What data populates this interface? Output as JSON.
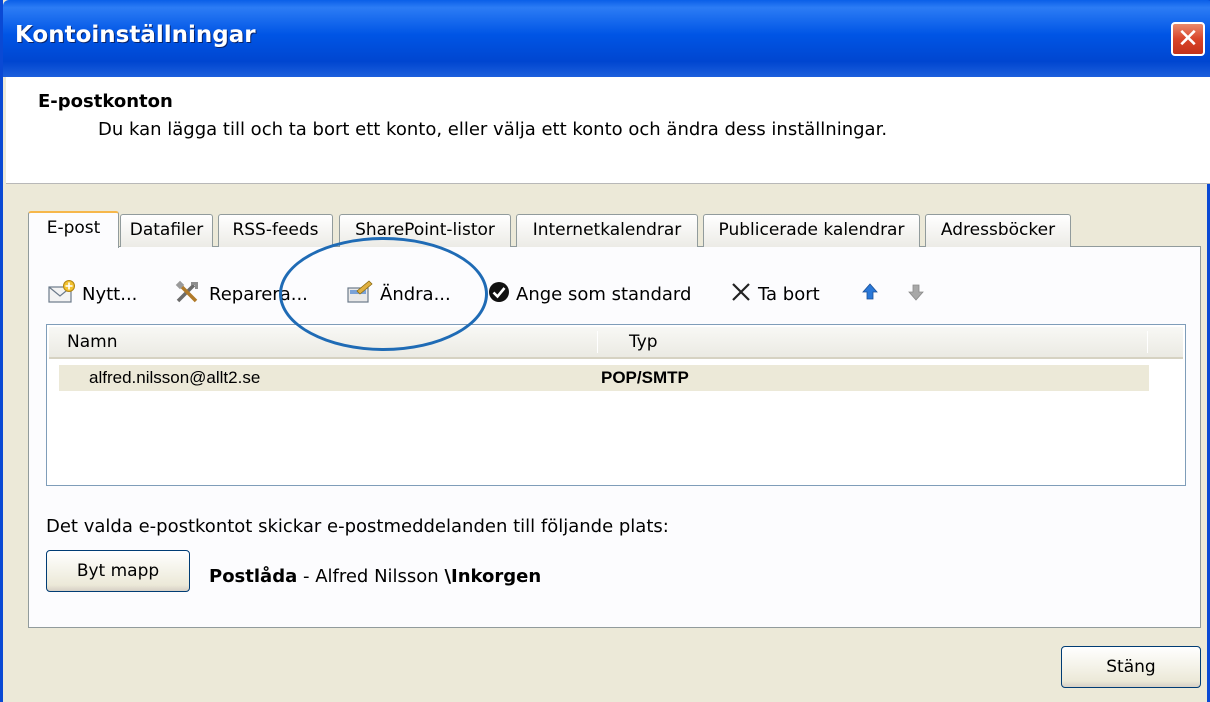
{
  "window": {
    "title": "Kontoinställningar",
    "close_glyph": "✕"
  },
  "header": {
    "title": "E-postkonton",
    "description": "Du kan lägga till och ta bort ett konto, eller välja ett konto och ändra dess inställningar."
  },
  "tabs": [
    {
      "label": "E-post",
      "active": true
    },
    {
      "label": "Datafiler"
    },
    {
      "label": "RSS-feeds"
    },
    {
      "label": "SharePoint-listor"
    },
    {
      "label": "Internetkalendrar"
    },
    {
      "label": "Publicerade kalendrar"
    },
    {
      "label": "Adressböcker"
    }
  ],
  "toolbar": {
    "new_label": "Nytt...",
    "repair_label": "Reparera...",
    "change_label": "Ändra...",
    "set_default_label": "Ange som standard",
    "delete_label": "Ta bort",
    "icons": [
      "new-mail-icon",
      "repair-tools-icon",
      "change-icon",
      "checkmark-icon",
      "delete-x-icon",
      "arrow-up-icon",
      "arrow-down-icon"
    ]
  },
  "account_list": {
    "columns": [
      "Namn",
      "Typ"
    ],
    "rows": [
      {
        "name": "alfred.nilsson@allt2.se",
        "type": "POP/SMTP"
      }
    ]
  },
  "delivery": {
    "description": "Det valda e-postkontot skickar e-postmeddelanden till följande plats:",
    "change_folder_label": "Byt mapp",
    "mailbox": "Postlåda",
    "separator": " - ",
    "owner": "Alfred Nilsson ",
    "backslash": "\\",
    "folder": "Inkorgen"
  },
  "footer": {
    "close_label": "Stäng"
  },
  "colors": {
    "titlebar": "#0055e5",
    "dialog_bg": "#ece9d8",
    "annotation_oval": "#1f6bb5"
  }
}
